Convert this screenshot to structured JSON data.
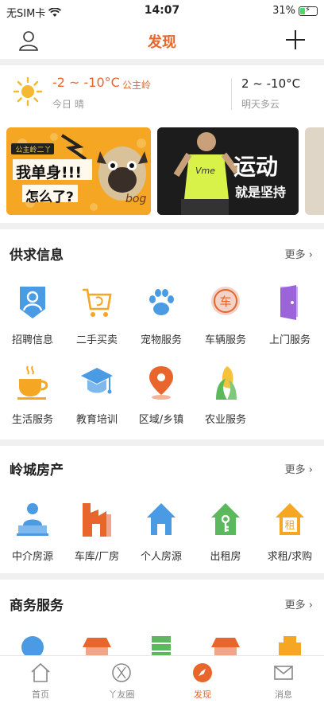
{
  "status": {
    "carrier": "无SIM卡",
    "time": "14:07",
    "battery": "31%",
    "battery_level": 0.31
  },
  "nav": {
    "title": "发现"
  },
  "weather": {
    "today_temp": "-2 ~ -10°C",
    "location": "公主岭",
    "today_label": "今日 晴",
    "tomorrow_temp": "2 ~ -10°C",
    "tomorrow_label": "明天多云"
  },
  "banners": [
    {
      "badge": "公主岭二丫",
      "line1": "我单身!!!",
      "line2": "怎么了?",
      "tail": "bog"
    },
    {
      "line1": "运动",
      "line2": "就是坚持",
      "shirt": "Vme"
    }
  ],
  "sections": {
    "supply": {
      "title": "供求信息",
      "more": "更多",
      "items": [
        {
          "label": "招聘信息",
          "icon": "recruit-icon"
        },
        {
          "label": "二手买卖",
          "icon": "cart-icon"
        },
        {
          "label": "宠物服务",
          "icon": "paw-icon"
        },
        {
          "label": "车辆服务",
          "icon": "vehicle-icon"
        },
        {
          "label": "上门服务",
          "icon": "door-icon"
        },
        {
          "label": "生活服务",
          "icon": "coffee-icon"
        },
        {
          "label": "教育培训",
          "icon": "graduation-cap-icon"
        },
        {
          "label": "区域/乡镇",
          "icon": "location-pin-icon"
        },
        {
          "label": "农业服务",
          "icon": "corn-icon"
        }
      ],
      "icon_texts": {
        "vehicle": "车"
      }
    },
    "realestate": {
      "title": "岭城房产",
      "more": "更多",
      "items": [
        {
          "label": "中介房源",
          "icon": "agent-icon"
        },
        {
          "label": "车库/厂房",
          "icon": "garage-icon"
        },
        {
          "label": "个人房源",
          "icon": "house-icon"
        },
        {
          "label": "出租房",
          "icon": "rent-key-icon"
        },
        {
          "label": "求租/求购",
          "icon": "rent-request-icon"
        }
      ],
      "icon_texts": {
        "rent": "租"
      }
    },
    "business": {
      "title": "商务服务",
      "more": "更多"
    }
  },
  "tabbar": {
    "items": [
      {
        "label": "首页",
        "icon": "home-icon"
      },
      {
        "label": "丫友圈",
        "icon": "circle-icon"
      },
      {
        "label": "发现",
        "icon": "compass-icon"
      },
      {
        "label": "消息",
        "icon": "message-icon"
      }
    ]
  },
  "colors": {
    "accent": "#e8652c",
    "blue": "#4a9be3",
    "orange": "#f5a623",
    "green": "#5cb85c"
  }
}
